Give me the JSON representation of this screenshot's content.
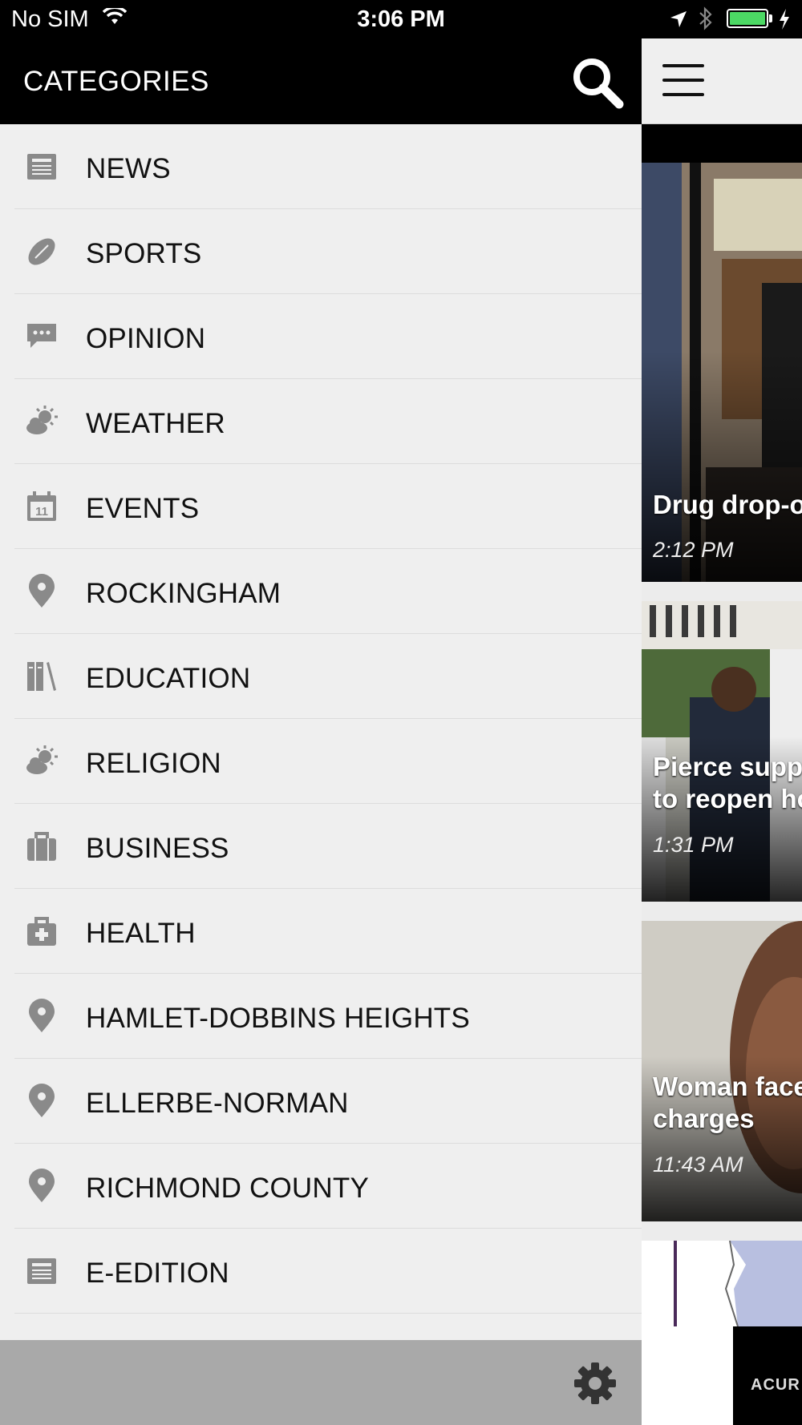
{
  "status_bar": {
    "carrier": "No SIM",
    "time": "3:06 PM"
  },
  "drawer": {
    "title": "CATEGORIES",
    "items": [
      {
        "label": "NEWS",
        "icon": "newspaper-icon"
      },
      {
        "label": "SPORTS",
        "icon": "football-icon"
      },
      {
        "label": "OPINION",
        "icon": "speech-bubble-icon"
      },
      {
        "label": "WEATHER",
        "icon": "sun-cloud-icon"
      },
      {
        "label": "EVENTS",
        "icon": "calendar-icon"
      },
      {
        "label": "ROCKINGHAM",
        "icon": "map-pin-icon"
      },
      {
        "label": "EDUCATION",
        "icon": "books-icon"
      },
      {
        "label": "RELIGION",
        "icon": "sun-cloud-icon"
      },
      {
        "label": "BUSINESS",
        "icon": "briefcase-icon"
      },
      {
        "label": "HEALTH",
        "icon": "medical-kit-icon"
      },
      {
        "label": "HAMLET-DOBBINS HEIGHTS",
        "icon": "map-pin-icon"
      },
      {
        "label": "ELLERBE-NORMAN",
        "icon": "map-pin-icon"
      },
      {
        "label": "RICHMOND COUNTY",
        "icon": "map-pin-icon"
      },
      {
        "label": "E-EDITION",
        "icon": "newspaper-icon"
      }
    ]
  },
  "feed": {
    "cards": [
      {
        "headline_lines": [
          "Drug drop-o"
        ],
        "time": "2:12 PM"
      },
      {
        "headline_lines": [
          "Pierce supp",
          "to reopen ho"
        ],
        "time": "1:31 PM"
      },
      {
        "headline_lines": [
          "Woman face",
          "charges"
        ],
        "time": "11:43 AM"
      }
    ],
    "ad_text": "ACUR"
  },
  "colors": {
    "header_bg": "#000000",
    "drawer_bg": "#efefef",
    "footer_bg": "#a9a9a9",
    "icon_gray": "#8a8a8a",
    "battery": "#4cd964"
  }
}
